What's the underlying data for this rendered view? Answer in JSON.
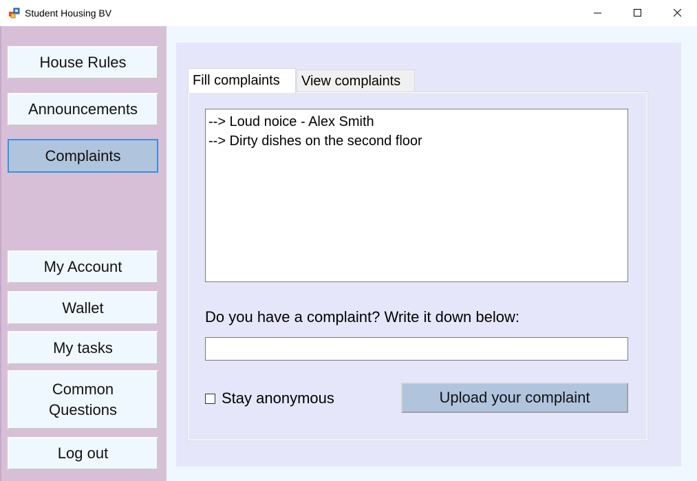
{
  "window": {
    "title": "Student Housing BV"
  },
  "sidebar": {
    "items": [
      {
        "label": "House Rules",
        "active": false
      },
      {
        "label": "Announcements",
        "active": false
      },
      {
        "label": "Complaints",
        "active": true
      },
      {
        "label": "My Account",
        "active": false
      },
      {
        "label": "Wallet",
        "active": false
      },
      {
        "label": "My tasks",
        "active": false
      },
      {
        "label": "Common Questions",
        "active": false
      },
      {
        "label": "Log out",
        "active": false
      }
    ]
  },
  "tabs": [
    {
      "label": "Fill complaints",
      "selected": true
    },
    {
      "label": "View complaints",
      "selected": false
    }
  ],
  "complaints": {
    "items": [
      "--> Loud noice - Alex Smith",
      "--> Dirty dishes on the second floor"
    ]
  },
  "form": {
    "prompt": "Do you have a complaint? Write it down below:",
    "input_value": "",
    "anonymous_label": "Stay anonymous",
    "anonymous_checked": false,
    "upload_label": "Upload your complaint"
  },
  "colors": {
    "sidebar_bg": "#d8bfd8",
    "nav_button_bg": "#f0f8ff",
    "active_button_bg": "#b0c4de",
    "active_button_border": "#3c8fdc",
    "panel_bg": "#e6e6fa",
    "main_bg": "#f0f8ff"
  }
}
